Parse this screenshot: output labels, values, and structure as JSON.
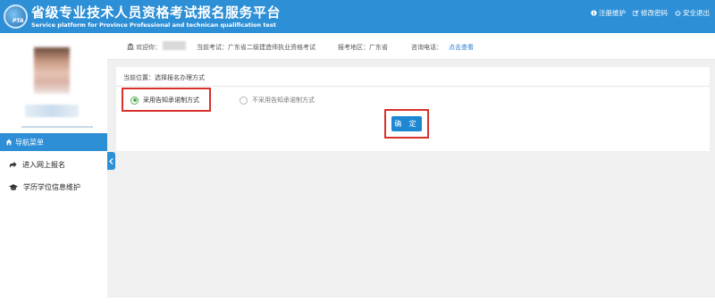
{
  "header": {
    "title": "省级专业技术人员资格考试报名服务平台",
    "subtitle": "Service platform for Province Professional and technican qualification test",
    "logo_text": "PTA",
    "links": [
      {
        "label": "注册维护",
        "icon": "info-icon"
      },
      {
        "label": "修改密码",
        "icon": "edit-icon"
      },
      {
        "label": "安全退出",
        "icon": "power-icon"
      }
    ]
  },
  "sidebar": {
    "nav_header": "导航菜单",
    "items": [
      {
        "label": "进入网上报名",
        "icon": "share-arrow-icon"
      },
      {
        "label": "学历学位信息维护",
        "icon": "graduation-cap-icon"
      }
    ]
  },
  "info_bar": {
    "welcome_label": "欢迎你：",
    "exam_label": "当前考试：广东省二级建造师执业资格考试",
    "region_label": "报考地区：广东省",
    "phone_label": "咨询电话：",
    "phone_link": "点击查看"
  },
  "panel": {
    "location": "当前位置：选择报名办理方式",
    "options": [
      {
        "label": "采用告知承诺制方式",
        "checked": true
      },
      {
        "label": "不采用告知承诺制方式",
        "checked": false
      }
    ],
    "confirm_label": "确 定"
  },
  "colors": {
    "brand_blue": "#2d8fd6",
    "highlight_red": "#d9302c",
    "radio_green": "#4caf50"
  }
}
